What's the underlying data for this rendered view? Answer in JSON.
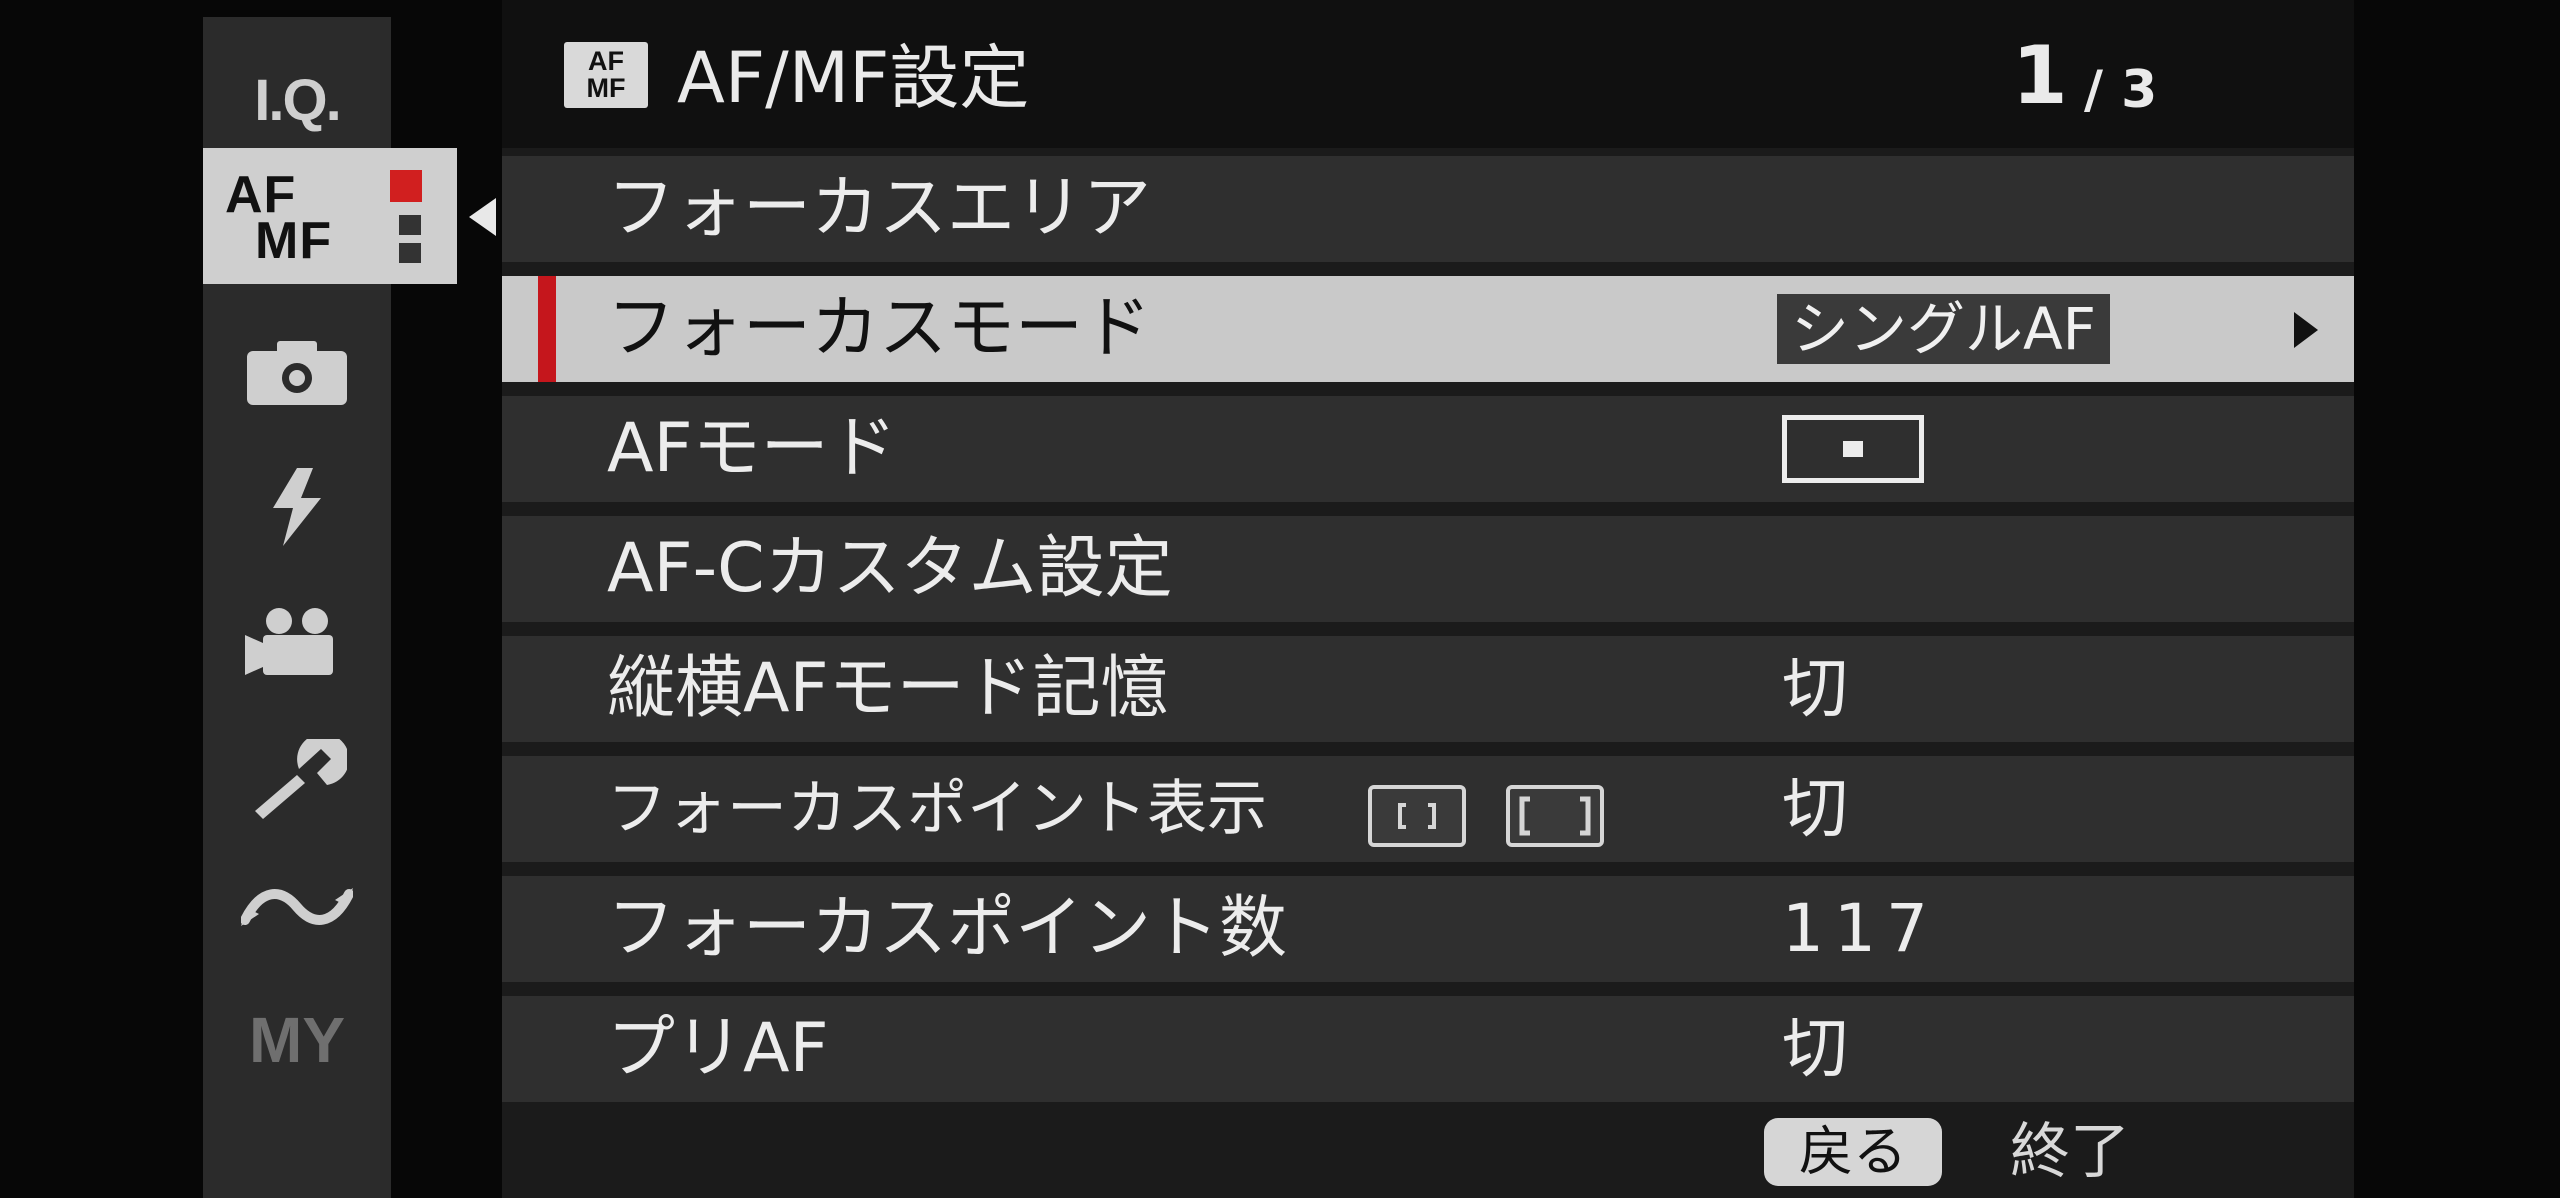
{
  "rail": {
    "iq_label": "I.Q.",
    "af_label_top": "AF",
    "af_label_bottom": "MF",
    "my_label": "MY",
    "icons": [
      "camera-icon",
      "flash-icon",
      "movie-icon",
      "wrench-icon",
      "connect-icon"
    ]
  },
  "header": {
    "badge_top": "AF",
    "badge_bottom": "MF",
    "title": "AF/MF設定",
    "page_current": "1",
    "page_total": "/ 3"
  },
  "menu": [
    {
      "label": "フォーカスエリア",
      "value": ""
    },
    {
      "label": "フォーカスモード",
      "value": "シングルAF",
      "selected": true
    },
    {
      "label": "AFモード",
      "value": "",
      "value_icon": "single-point-af-icon"
    },
    {
      "label": "AF-Cカスタム設定",
      "value": ""
    },
    {
      "label": "縦横AFモード記憶",
      "value": "切"
    },
    {
      "label": "フォーカスポイント表示",
      "value": "切",
      "label_icons": [
        "zone-af-icon",
        "wide-tracking-af-icon"
      ]
    },
    {
      "label": "フォーカスポイント数",
      "value": "117"
    },
    {
      "label": "プリAF",
      "value": "切"
    }
  ],
  "footer": {
    "back_label": "戻る",
    "end_label": "終了"
  },
  "colors": {
    "selection_marker": "#c5161c",
    "af_tab_indicator": "#d11f1f",
    "selected_row": "#c9c9c9"
  }
}
